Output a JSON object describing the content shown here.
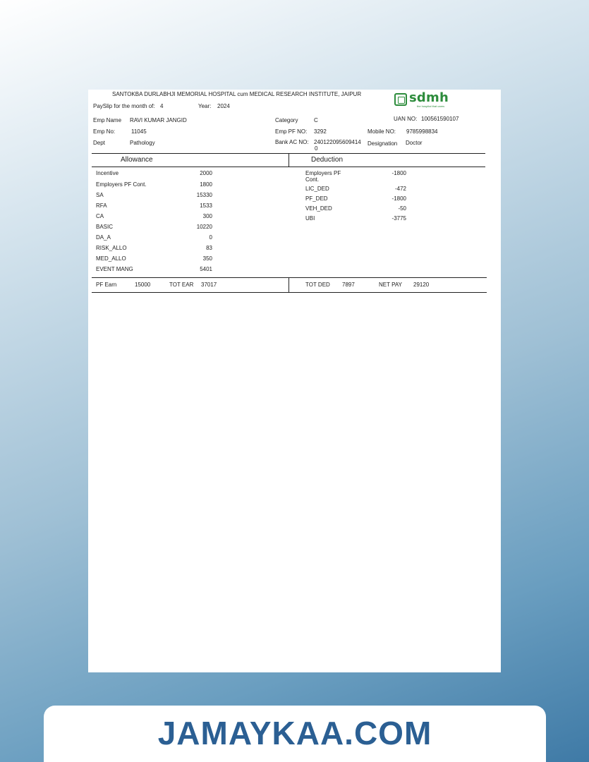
{
  "hospital_name": "SANTOKBA DURLABHJI MEMORIAL HOSPITAL cum MEDICAL RESEARCH INSTITUTE, JAIPUR",
  "logo": {
    "text": "sdmh",
    "tagline": "the hospital that cares",
    "icon": "sdmh-logo-icon",
    "color": "#2d8c3c"
  },
  "payslip_label": "PaySlip for the month of:",
  "month": "4",
  "year_label": "Year:",
  "year": "2024",
  "employee": {
    "name_label": "Emp Name",
    "name": "RAVI KUMAR JANGID",
    "no_label": "Emp No:",
    "no": "11045",
    "dept_label": "Dept",
    "dept": "Pathology",
    "category_label": "Category",
    "category": "C",
    "pf_no_label": "Emp PF NO:",
    "pf_no": "3292",
    "bank_label": "Bank AC NO:",
    "bank_line1": "240122095609414",
    "bank_line2": "0",
    "uan_label": "UAN NO:",
    "uan": "100561590107",
    "mobile_label": "Mobile NO:",
    "mobile": "9785998834",
    "designation_label": "Designation",
    "designation": "Doctor"
  },
  "allowance_header": "Allowance",
  "deduction_header": "Deduction",
  "allowances": [
    {
      "label": "Incentive",
      "value": "2000"
    },
    {
      "label": "Employers PF Cont.",
      "value": "1800"
    },
    {
      "label": "SA",
      "value": "15330"
    },
    {
      "label": "RFA",
      "value": "1533"
    },
    {
      "label": "CA",
      "value": "300"
    },
    {
      "label": "BASIC",
      "value": "10220"
    },
    {
      "label": "DA_A",
      "value": "0"
    },
    {
      "label": "RISK_ALLO",
      "value": "83"
    },
    {
      "label": "MED_ALLO",
      "value": "350"
    },
    {
      "label": "EVENT MANG",
      "value": "5401"
    }
  ],
  "deductions": [
    {
      "label": "Employers PF",
      "label2": "Cont.",
      "value": "-1800"
    },
    {
      "label": "LIC_DED",
      "value": "-472"
    },
    {
      "label": "PF_DED",
      "value": "-1800"
    },
    {
      "label": "VEH_DED",
      "value": "-50"
    },
    {
      "label": "UBI",
      "value": "-3775"
    }
  ],
  "totals": {
    "pf_earn_label": "PF Earn",
    "pf_earn": "15000",
    "tot_ear_label": "TOT EAR",
    "tot_ear": "37017",
    "tot_ded_label": "TOT DED",
    "tot_ded": "7897",
    "net_pay_label": "NET PAY",
    "net_pay": "29120"
  },
  "watermark": "JAMAYKAA.COM"
}
